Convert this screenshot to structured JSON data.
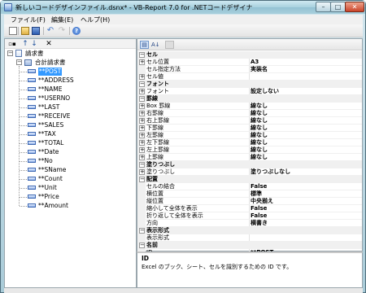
{
  "window": {
    "title": "新しいコードデザインファイル.dsnx* - VB-Report 7.0 for .NETコードデザイナ",
    "min_glyph": "–",
    "max_glyph": "□",
    "close_glyph": "✕"
  },
  "menu": [
    "ファイル(F)",
    "編集(E)",
    "ヘルプ(H)"
  ],
  "toolbar": [
    "new-file",
    "open-folder",
    "save",
    "undo",
    "redo",
    "help"
  ],
  "toolbar_glyphs": {
    "undo": "↶",
    "redo": "↷",
    "help": "?"
  },
  "left_tools": {
    "add_section": "▫▪",
    "move_up": "↑",
    "move_down": "↓",
    "delete": "✕"
  },
  "tree": {
    "root": "請求書",
    "section": "合計請求書",
    "cells": [
      "**POST",
      "**ADDRESS",
      "**NAME",
      "**USERNO",
      "**LAST",
      "**RECEIVE",
      "**SALES",
      "**TAX",
      "**TOTAL",
      "**Date",
      "**No",
      "**SName",
      "**Count",
      "**Unit",
      "**Price",
      "**Amount"
    ],
    "selected_index": 0
  },
  "grid_tools": {
    "categorized": "▤",
    "alphabetical": "A↓"
  },
  "grid": [
    {
      "kind": "cat",
      "name": "セル"
    },
    {
      "kind": "prop",
      "name": "セル位置",
      "value": "A3",
      "exp": true
    },
    {
      "kind": "prop",
      "name": "セル指定方法",
      "value": "実装名"
    },
    {
      "kind": "prop",
      "name": "セル値",
      "value": "",
      "exp": true
    },
    {
      "kind": "cat",
      "name": "フォント"
    },
    {
      "kind": "prop",
      "name": "フォント",
      "value": "設定しない",
      "exp": true
    },
    {
      "kind": "cat",
      "name": "罫線"
    },
    {
      "kind": "prop",
      "name": "Box 罫線",
      "value": "線なし",
      "exp": true
    },
    {
      "kind": "prop",
      "name": "右罫線",
      "value": "線なし",
      "exp": true
    },
    {
      "kind": "prop",
      "name": "右上罫線",
      "value": "線なし",
      "exp": true
    },
    {
      "kind": "prop",
      "name": "下罫線",
      "value": "線なし",
      "exp": true
    },
    {
      "kind": "prop",
      "name": "左罫線",
      "value": "線なし",
      "exp": true
    },
    {
      "kind": "prop",
      "name": "左下罫線",
      "value": "線なし",
      "exp": true
    },
    {
      "kind": "prop",
      "name": "左上罫線",
      "value": "線なし",
      "exp": true
    },
    {
      "kind": "prop",
      "name": "上罫線",
      "value": "線なし",
      "exp": true
    },
    {
      "kind": "cat",
      "name": "塗りつぶし"
    },
    {
      "kind": "prop",
      "name": "塗りつぶし",
      "value": "塗りつぶしなし",
      "exp": true
    },
    {
      "kind": "cat",
      "name": "配置"
    },
    {
      "kind": "prop",
      "name": "セルの結合",
      "value": "False"
    },
    {
      "kind": "prop",
      "name": "横位置",
      "value": "標準"
    },
    {
      "kind": "prop",
      "name": "縦位置",
      "value": "中央揃え"
    },
    {
      "kind": "prop",
      "name": "縮小して全体を表示",
      "value": "False"
    },
    {
      "kind": "prop",
      "name": "折り返して全体を表示",
      "value": "False"
    },
    {
      "kind": "prop",
      "name": "方向",
      "value": "横書き"
    },
    {
      "kind": "cat",
      "name": "表示形式"
    },
    {
      "kind": "prop",
      "name": "表示形式",
      "value": ""
    },
    {
      "kind": "cat",
      "name": "名前"
    },
    {
      "kind": "prop",
      "name": "ID",
      "value": "**POST"
    }
  ],
  "description": {
    "title": "ID",
    "text": "Excel のブック、シート、セルを識別するための ID です。"
  }
}
